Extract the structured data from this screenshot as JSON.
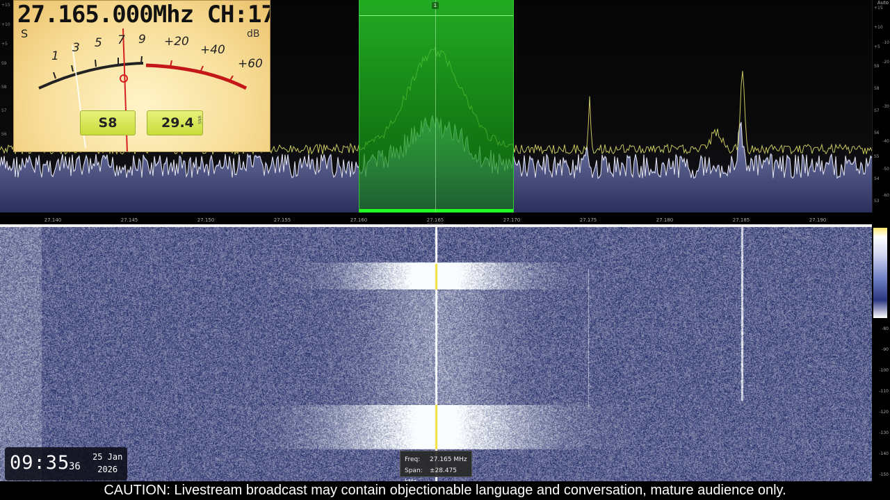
{
  "overlay": {
    "frequency_title": "27.165.000Mhz CH:17",
    "caution": "CAUTION:  Livestream broadcast may contain objectionable language and conversation, mature audience only."
  },
  "smeter": {
    "s_label": "S",
    "db_label": "dB",
    "s_scale": [
      "1",
      "3",
      "5",
      "7",
      "9"
    ],
    "db_scale": [
      "+20",
      "+40",
      "+60"
    ],
    "s_reading": "S8",
    "snr_value": "29.4",
    "snr_label": "SNR"
  },
  "spectrum": {
    "vfo_id": "1",
    "auto_label": "Auto",
    "right_db_ticks": [
      "+15",
      "+10",
      "+5",
      "S9",
      "S8",
      "S7",
      "S6",
      "S5",
      "S4",
      "S3"
    ],
    "right_db_ticks2": [
      "-10",
      "-20",
      "-30",
      "-40",
      "-50",
      "-60"
    ],
    "freq_labels": [
      "27.140",
      "27.145",
      "27.150",
      "27.155",
      "27.160",
      "27.165",
      "27.170",
      "27.175",
      "27.180",
      "27.185",
      "27.190"
    ]
  },
  "waterfall": {
    "scale_ticks": [
      "-80",
      "-90",
      "-100",
      "-110",
      "-120",
      "-130",
      "-140",
      "-150"
    ]
  },
  "tooltip": {
    "freq_label": "Freq:",
    "freq_value": "27.165 MHz",
    "span_label": "Span:",
    "span_value": "±28.475 kHz"
  },
  "clock": {
    "hour_min": "09:35",
    "seconds": "36",
    "date_day": "25 Jan",
    "date_year": "2026"
  },
  "colors": {
    "vfo_green": "#22cc22",
    "meter_face": "#f7dc95",
    "meter_red": "#c41818",
    "waterfall_bg": "#1f2a6b",
    "trace_yellow": "#c8c860"
  }
}
